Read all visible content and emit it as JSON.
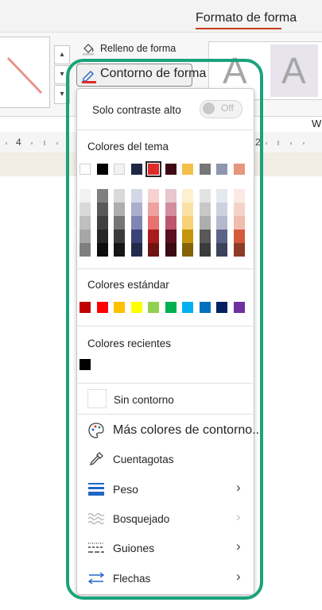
{
  "ribbon": {
    "tab_title": "Formato de forma",
    "fill_label": "Relleno de forma",
    "outline_label": "Contorno de forma",
    "wordart_letter": "A",
    "side_letter": "W",
    "ruler_left": "4",
    "ruler_right": "2"
  },
  "panel": {
    "high_contrast_label": "Solo contraste alto",
    "toggle_state": "Off",
    "theme_colors_label": "Colores del tema",
    "standard_colors_label": "Colores estándar",
    "recent_colors_label": "Colores recientes",
    "no_outline_label": "Sin contorno",
    "more_colors_label": "Más colores de contorno...",
    "eyedropper_label": "Cuentagotas",
    "weight_label": "Peso",
    "sketched_label": "Bosquejado",
    "dashes_label": "Guiones",
    "arrows_label": "Flechas"
  },
  "theme_colors": [
    "#ffffff",
    "#000000",
    "#f2f2f2",
    "#1f2747",
    "#e02b2b",
    "#400a14",
    "#f5c04a",
    "#767676",
    "#8e96b0",
    "#e7967e"
  ],
  "theme_shades": [
    [
      "#f2f2f2",
      "#d9d9d9",
      "#bfbfbf",
      "#a6a6a6",
      "#7f7f7f"
    ],
    [
      "#7f7f7f",
      "#595959",
      "#3f3f3f",
      "#262626",
      "#0d0d0d"
    ],
    [
      "#d9d9d9",
      "#aeaeae",
      "#757575",
      "#3a3a3a",
      "#161616"
    ],
    [
      "#d4d7e6",
      "#a9afcc",
      "#7e86b3",
      "#3a4278",
      "#242a4b"
    ],
    [
      "#f7d0d0",
      "#efa0a0",
      "#e87171",
      "#a81c1c",
      "#701313"
    ],
    [
      "#e8c7cf",
      "#d28e9e",
      "#bb566e",
      "#5a0f1e",
      "#3c0a14"
    ],
    [
      "#fdf0d1",
      "#fbe2a4",
      "#f8d176",
      "#c6950c",
      "#846308"
    ],
    [
      "#e3e3e3",
      "#c8c8c8",
      "#adadad",
      "#585858",
      "#3b3b3b"
    ],
    [
      "#e6e8ef",
      "#cdd1df",
      "#b4b9cf",
      "#5b6387",
      "#3c425a"
    ],
    [
      "#fbe9e4",
      "#f6d3c9",
      "#f1bdae",
      "#d45a3a",
      "#8d3c27"
    ]
  ],
  "standard_colors": [
    "#c00000",
    "#ff0000",
    "#ffc000",
    "#ffff00",
    "#92d050",
    "#00b050",
    "#00b0f0",
    "#0070c0",
    "#002060",
    "#7030a0"
  ],
  "recent_colors": [
    "#000000"
  ],
  "accents": {
    "highlight": "#1aa37a",
    "tab_underline": "#c43e1c",
    "outline_red": "#e02b2b",
    "icon_blue": "#2266c9"
  }
}
